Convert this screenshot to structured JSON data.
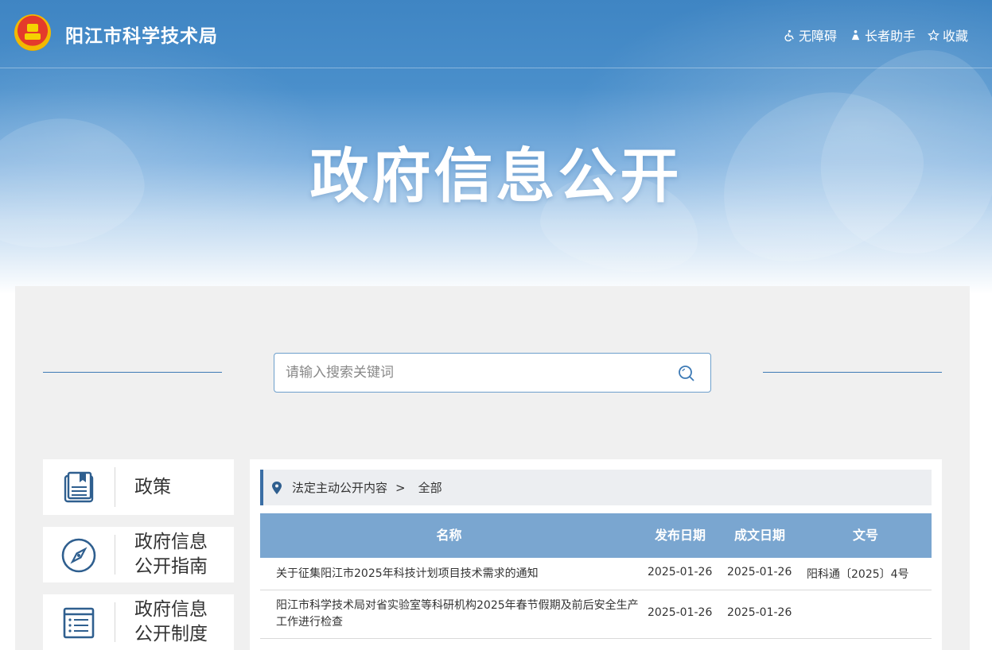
{
  "header": {
    "site_title": "阳江市科学技术局",
    "utilities": [
      {
        "label": "无障碍",
        "icon": "accessibility-icon"
      },
      {
        "label": "长者助手",
        "icon": "elder-assistant-icon"
      },
      {
        "label": "收藏",
        "icon": "star-icon"
      }
    ],
    "hero_title": "政府信息公开"
  },
  "search": {
    "placeholder": "请输入搜索关键词",
    "icon": "search-icon"
  },
  "sidebar": {
    "items": [
      {
        "label": "政策",
        "icon": "policy-book-icon"
      },
      {
        "label": "政府信息公开指南",
        "line1": "政府信息",
        "line2": "公开指南",
        "icon": "compass-icon"
      },
      {
        "label": "政府信息公开制度",
        "line1": "政府信息",
        "line2": "公开制度",
        "icon": "document-list-icon"
      }
    ]
  },
  "breadcrumb": {
    "section": "法定主动公开内容",
    "separator": ">",
    "current": "全部"
  },
  "table": {
    "columns": [
      "名称",
      "发布日期",
      "成文日期",
      "文号"
    ],
    "rows": [
      {
        "name": "关于征集阳江市2025年科技计划项目技术需求的通知",
        "publish_date": "2025-01-26",
        "written_date": "2025-01-26",
        "doc_number": "阳科通〔2025〕4号"
      },
      {
        "name": "阳江市科学技术局对省实验室等科研机构2025年春节假期及前后安全生产工作进行检查",
        "name_line1": "阳江市科学技术局对省实验室等科研机构2025年春节假期及前后安全生产",
        "name_line2": "工作进行检查",
        "publish_date": "2025-01-26",
        "written_date": "2025-01-26",
        "doc_number": ""
      }
    ]
  },
  "colors": {
    "banner_blue": "#4a8fcb",
    "header_row": "#7aa6d0",
    "accent": "#3a6ea5",
    "panel_bg": "#f0f0f0"
  }
}
